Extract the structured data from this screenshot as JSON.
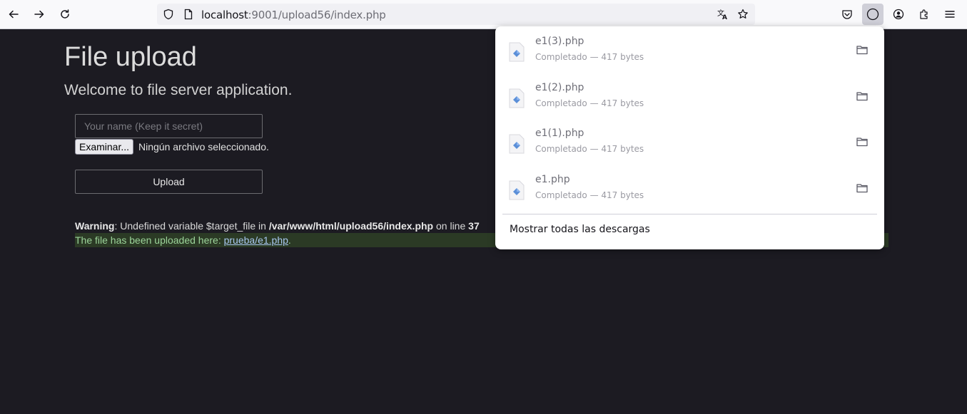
{
  "browser": {
    "url_host": "localhost",
    "url_rest": ":9001/upload56/index.php"
  },
  "page": {
    "title": "File upload",
    "subtitle": "Welcome to file server application.",
    "name_placeholder": "Your name (Keep it secret)",
    "file_button_label": "Examinar...",
    "file_status": "Ningún archivo seleccionado.",
    "upload_label": "Upload",
    "warning": {
      "label": "Warning",
      "text1": ": Undefined variable $target_file in ",
      "path": "/var/www/html/upload56/index.php",
      "text2": " on line ",
      "line": "37"
    },
    "success": {
      "text": "The file has been uploaded here: ",
      "link": "prueba/e1.php",
      "end": "."
    }
  },
  "downloads": {
    "items": [
      {
        "name": "e1(3).php",
        "status": "Completado — 417 bytes"
      },
      {
        "name": "e1(2).php",
        "status": "Completado — 417 bytes"
      },
      {
        "name": "e1(1).php",
        "status": "Completado — 417 bytes"
      },
      {
        "name": "e1.php",
        "status": "Completado — 417 bytes"
      }
    ],
    "show_all_label": "Mostrar todas las descargas"
  }
}
